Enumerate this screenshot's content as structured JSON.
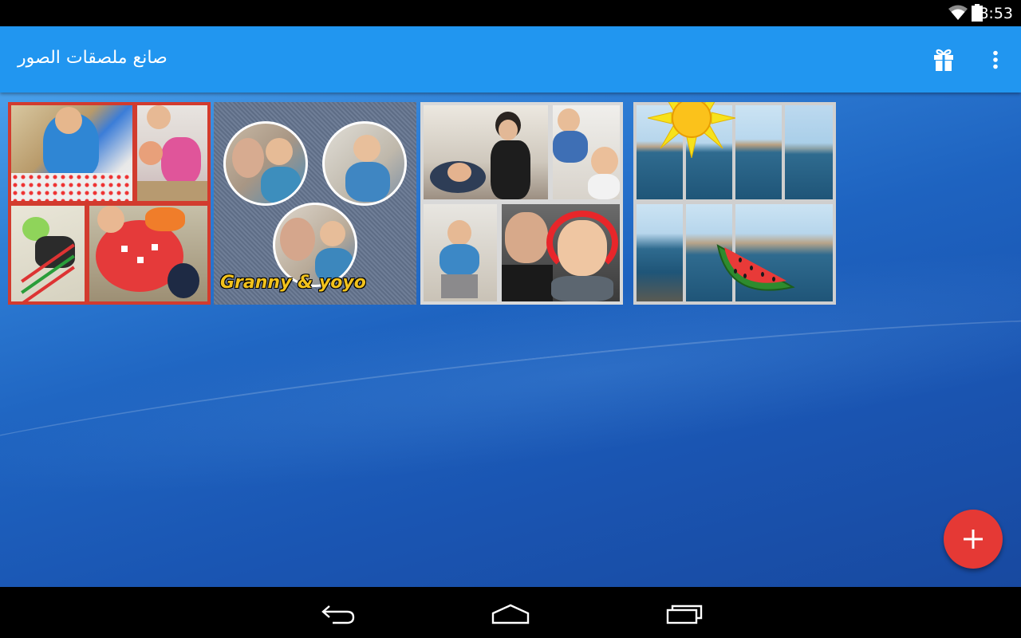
{
  "status_bar": {
    "time": "8:53"
  },
  "app_bar": {
    "title": "صانع ملصقات الصور"
  },
  "collages": [
    {
      "name": "collage-kids-playing"
    },
    {
      "name": "collage-granny-yoyo",
      "caption": "Granny & yoyo"
    },
    {
      "name": "collage-family-kitchen"
    },
    {
      "name": "collage-sea-summer"
    }
  ],
  "colors": {
    "app_bar": "#2196f0",
    "fab": "#e53935",
    "background": "#1e63c0"
  },
  "icons": [
    "wifi-icon",
    "battery-icon",
    "gift-icon",
    "more-vert-icon",
    "plus-icon",
    "back-icon",
    "home-icon",
    "recents-icon"
  ]
}
